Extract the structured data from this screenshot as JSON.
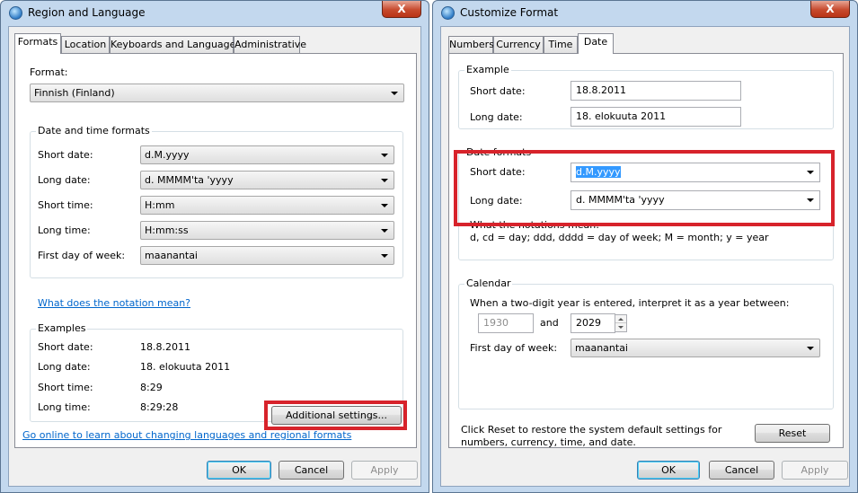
{
  "region": {
    "title": "Region and Language",
    "close": "X",
    "tabs": [
      "Formats",
      "Location",
      "Keyboards and Languages",
      "Administrative"
    ],
    "format_label": "Format:",
    "format_value": "Finnish (Finland)",
    "dt_group": "Date and time formats",
    "fields": [
      {
        "label": "Short date:",
        "value": "d.M.yyyy"
      },
      {
        "label": "Long date:",
        "value": "d. MMMM'ta 'yyyy"
      },
      {
        "label": "Short time:",
        "value": "H:mm"
      },
      {
        "label": "Long time:",
        "value": "H:mm:ss"
      },
      {
        "label": "First day of week:",
        "value": "maanantai"
      }
    ],
    "notation_link": "What does the notation mean?",
    "examples_group": "Examples",
    "examples": [
      {
        "label": "Short date:",
        "value": "18.8.2011"
      },
      {
        "label": "Long date:",
        "value": "18. elokuuta 2011"
      },
      {
        "label": "Short time:",
        "value": "8:29"
      },
      {
        "label": "Long time:",
        "value": "8:29:28"
      }
    ],
    "additional": "Additional settings...",
    "online_link": "Go online to learn about changing languages and regional formats",
    "ok": "OK",
    "cancel": "Cancel",
    "apply": "Apply"
  },
  "custom": {
    "title": "Customize Format",
    "close": "X",
    "tabs": [
      "Numbers",
      "Currency",
      "Time",
      "Date"
    ],
    "example_group": "Example",
    "ex_short_label": "Short date:",
    "ex_short_value": "18.8.2011",
    "ex_long_label": "Long date:",
    "ex_long_value": "18. elokuuta 2011",
    "formats_group": "Date formats",
    "fmt_short_label": "Short date:",
    "fmt_short_value": "d.M.yyyy",
    "fmt_long_label": "Long date:",
    "fmt_long_value": "d. MMMM'ta 'yyyy",
    "notation_title": "What the notations mean:",
    "notation_text": "d, cd = day;  ddd, dddd = day of week;  M = month;  y = year",
    "calendar_group": "Calendar",
    "two_digit": "When a two-digit year is entered, interpret it as a year between:",
    "year_from": "1930",
    "and": "and",
    "year_to": "2029",
    "first_day_label": "First day of week:",
    "first_day_value": "maanantai",
    "reset_text_1": "Click Reset to restore the system default settings for",
    "reset_text_2": "numbers, currency, time, and date.",
    "reset": "Reset",
    "ok": "OK",
    "cancel": "Cancel",
    "apply": "Apply"
  },
  "colors": {
    "highlight": "#d7232b",
    "link": "#0066cc",
    "selection": "#3399ff"
  }
}
